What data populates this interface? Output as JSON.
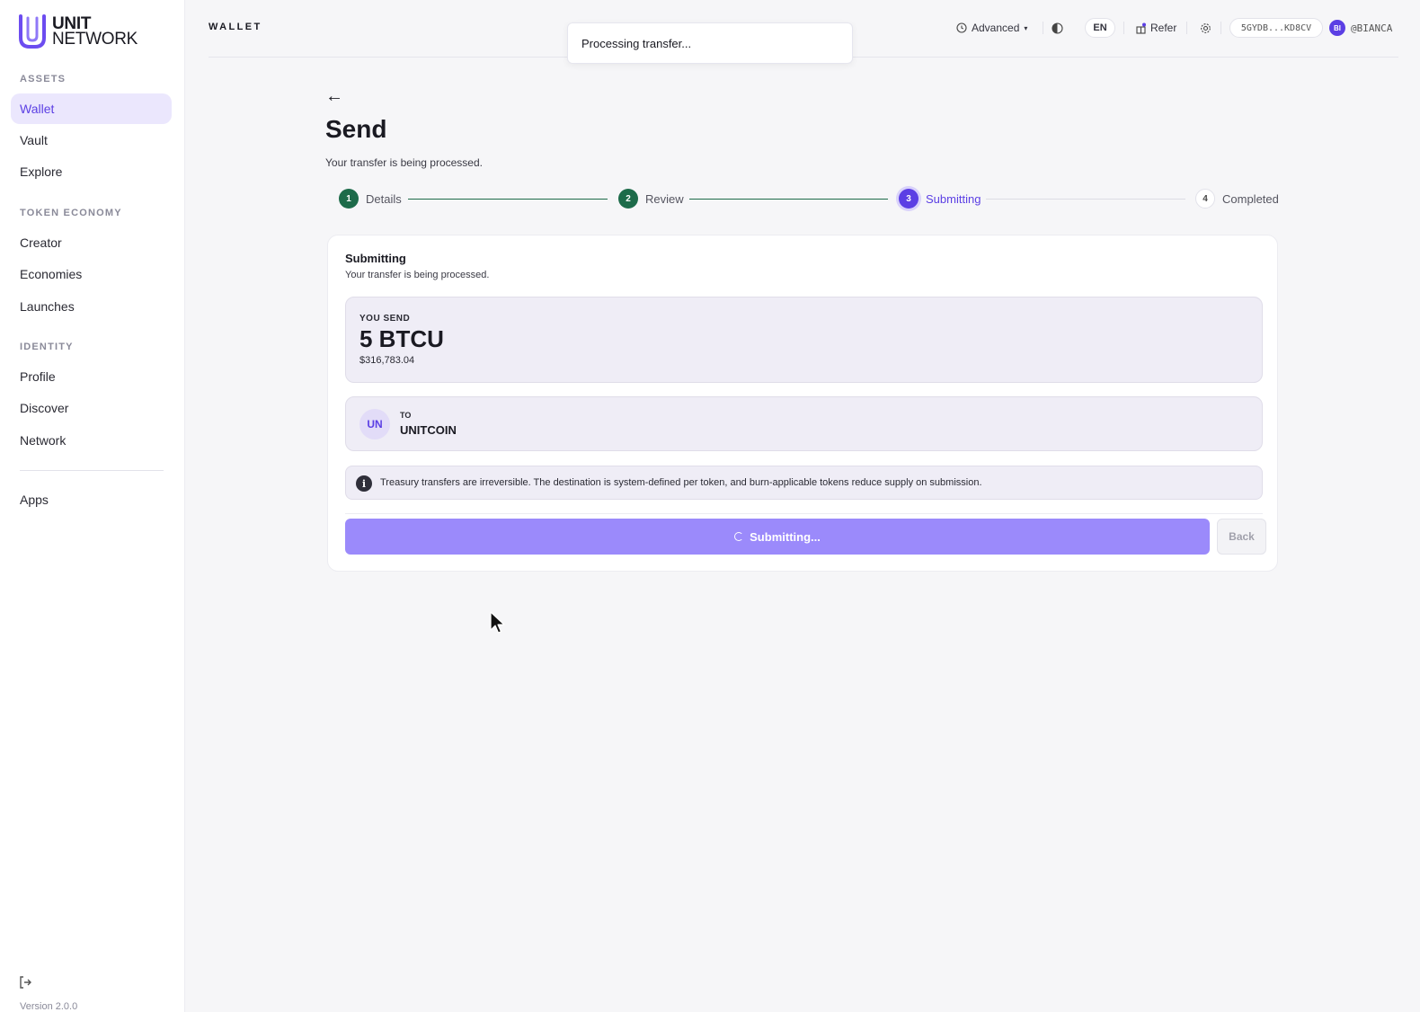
{
  "brand": {
    "line1": "UNIT",
    "line2": "NETWORK"
  },
  "sidebar": {
    "sections": [
      {
        "label": "ASSETS",
        "items": [
          "Wallet",
          "Vault",
          "Explore"
        ]
      },
      {
        "label": "TOKEN ECONOMY",
        "items": [
          "Creator",
          "Economies",
          "Launches"
        ]
      },
      {
        "label": "IDENTITY",
        "items": [
          "Profile",
          "Discover",
          "Network"
        ]
      }
    ],
    "extra_item": "Apps",
    "active_item": "Wallet",
    "version": "Version 2.0.0",
    "logout_icon": "logout-icon"
  },
  "topbar": {
    "title": "WALLET",
    "mode_label": "Advanced",
    "lang": "EN",
    "refer_label": "Refer",
    "address": "5GYDB...KD8CV",
    "user_initials": "BI",
    "username": "@BIANCA"
  },
  "toast": {
    "message": "Processing transfer..."
  },
  "page": {
    "title": "Send",
    "subtitle": "Your transfer is being processed."
  },
  "steps": [
    {
      "number": "1",
      "label": "Details",
      "state": "done"
    },
    {
      "number": "2",
      "label": "Review",
      "state": "done"
    },
    {
      "number": "3",
      "label": "Submitting",
      "state": "current"
    },
    {
      "number": "4",
      "label": "Completed",
      "state": "todo"
    }
  ],
  "card": {
    "title": "Submitting",
    "subtitle": "Your transfer is being processed.",
    "send_label": "YOU SEND",
    "amount": "5 BTCU",
    "usd_value": "$316,783.04",
    "to_label": "TO",
    "to_initials": "UN",
    "to_name": "UNITCOIN",
    "info_text": "Treasury transfers are irreversible. The destination is system-defined per token, and burn-applicable tokens reduce supply on submission.",
    "submit_label": "Submitting...",
    "back_label": "Back"
  },
  "colors": {
    "accent": "#5b3fe4",
    "accent_light": "#9b8afb",
    "done_green": "#1d6b4a"
  }
}
